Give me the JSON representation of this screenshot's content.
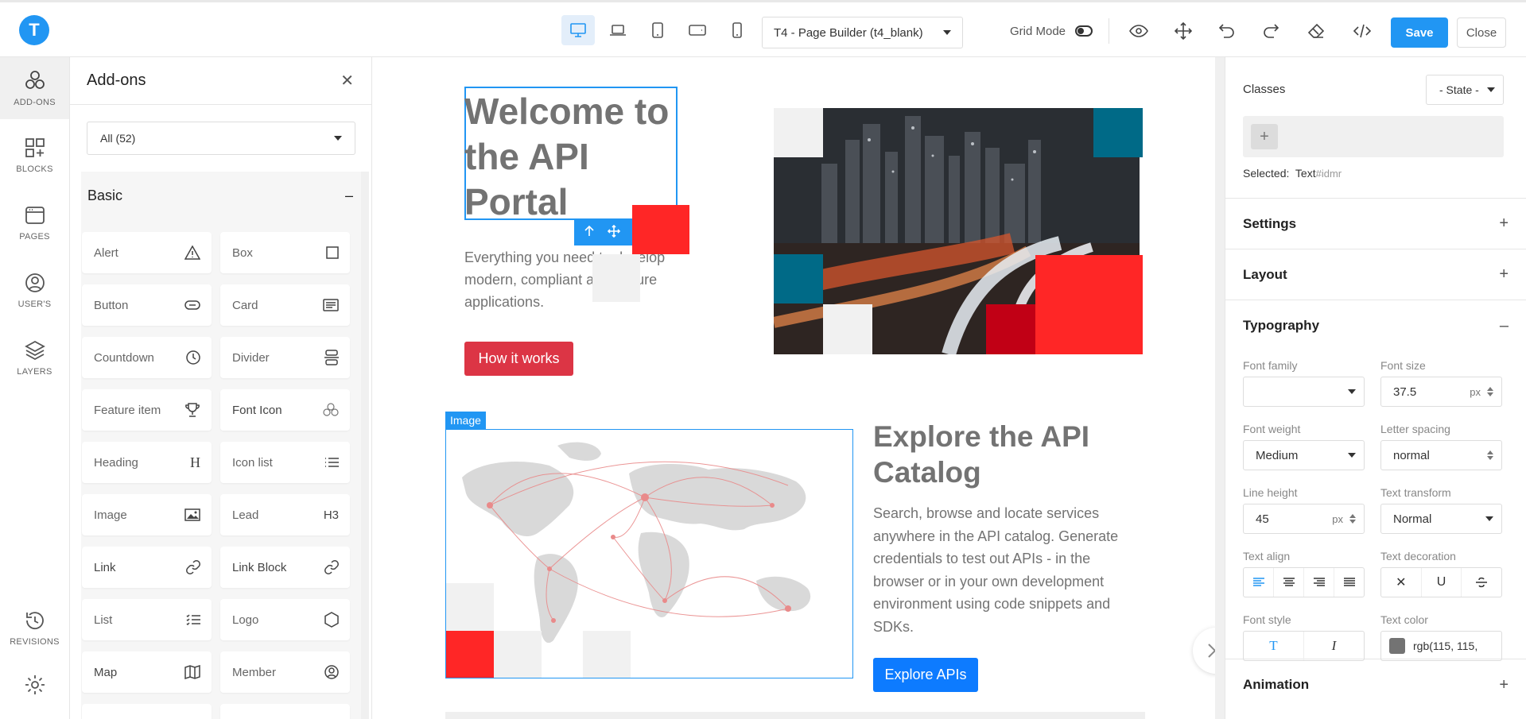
{
  "app": {
    "logo_letter": "T",
    "template_select": "T4 - Page Builder (t4_blank)",
    "grid_mode_label": "Grid Mode",
    "save_label": "Save",
    "close_label": "Close",
    "accent_color": "#2196f3"
  },
  "rail": {
    "items": [
      {
        "label": "ADD-ONS",
        "icon": "addons-icon"
      },
      {
        "label": "BLOCKS",
        "icon": "blocks-icon"
      },
      {
        "label": "PAGES",
        "icon": "pages-icon"
      },
      {
        "label": "USER'S",
        "icon": "user-icon"
      },
      {
        "label": "LAYERS",
        "icon": "layers-icon"
      },
      {
        "label": "REVISIONS",
        "icon": "revisions-icon"
      },
      {
        "label": "",
        "icon": "settings-icon"
      }
    ]
  },
  "addons": {
    "title": "Add-ons",
    "filter_value": "All (52)",
    "section_title": "Basic",
    "items": [
      {
        "label": "Alert",
        "icon": "warning-icon"
      },
      {
        "label": "Box",
        "icon": "square-icon"
      },
      {
        "label": "Button",
        "icon": "button-icon"
      },
      {
        "label": "Card",
        "icon": "card-icon"
      },
      {
        "label": "Countdown",
        "icon": "clock-icon"
      },
      {
        "label": "Divider",
        "icon": "divider-icon"
      },
      {
        "label": "Feature item",
        "icon": "trophy-icon"
      },
      {
        "label": "Font Icon",
        "icon": "font-icon-icon"
      },
      {
        "label": "Heading",
        "icon": "heading-icon"
      },
      {
        "label": "Icon list",
        "icon": "list-icon"
      },
      {
        "label": "Image",
        "icon": "image-icon"
      },
      {
        "label": "Lead",
        "icon": "h3-icon"
      },
      {
        "label": "Link",
        "icon": "link-icon"
      },
      {
        "label": "Link Block",
        "icon": "link-icon"
      },
      {
        "label": "List",
        "icon": "checklist-icon"
      },
      {
        "label": "Logo",
        "icon": "hexagon-icon"
      },
      {
        "label": "Map",
        "icon": "map-icon"
      },
      {
        "label": "Member",
        "icon": "member-icon"
      }
    ],
    "lead_icon_text": "H3"
  },
  "canvas": {
    "hero_title": "Welcome to the API Portal",
    "hero_subtitle": "Everything you need to develop modern, compliant and secure applications.",
    "hero_button": "How it works",
    "image_tag": "Image",
    "explore_title": "Explore the API Catalog",
    "explore_text": "Search, browse and locate services anywhere in the API catalog. Generate credentials to test out APIs - in the browser or in your own development environment using code snippets and SDKs.",
    "explore_button": "Explore APIs",
    "colors": {
      "red": "#ff2626",
      "dark_red": "#c10015",
      "teal": "#006a87",
      "light_gray": "#f1f1f1",
      "btn_red": "#dc3545",
      "btn_blue": "#0d7bff"
    }
  },
  "inspector": {
    "classes_label": "Classes",
    "state_select": "- State -",
    "selected_label": "Selected:",
    "selected_type": "Text",
    "selected_id": "#idmr",
    "sections": {
      "settings": "Settings",
      "layout": "Layout",
      "typography": "Typography",
      "animation": "Animation"
    },
    "typography": {
      "font_family_label": "Font family",
      "font_family_value": "",
      "font_size_label": "Font size",
      "font_size_value": "37.5",
      "font_size_unit": "px",
      "font_weight_label": "Font weight",
      "font_weight_value": "Medium",
      "letter_spacing_label": "Letter spacing",
      "letter_spacing_value": "normal",
      "line_height_label": "Line height",
      "line_height_value": "45",
      "line_height_unit": "px",
      "text_transform_label": "Text transform",
      "text_transform_value": "Normal",
      "text_align_label": "Text align",
      "text_decoration_label": "Text decoration",
      "decoration_underline": "U",
      "font_style_label": "Font style",
      "text_color_label": "Text color",
      "text_color_value": "rgb(115, 115,",
      "text_color_swatch": "#737373"
    }
  }
}
